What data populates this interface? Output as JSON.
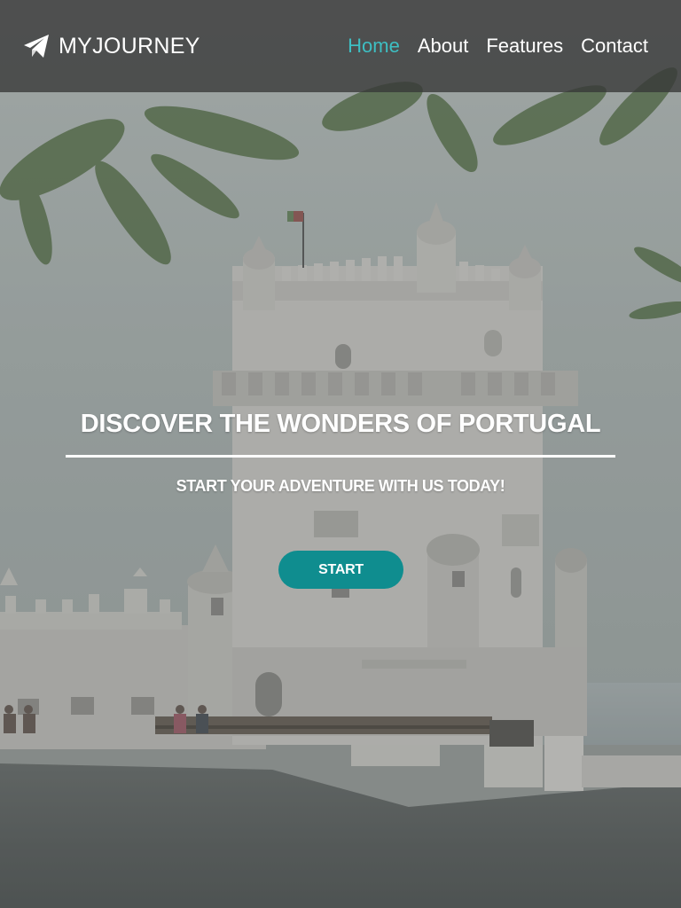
{
  "brand": {
    "name": "MYJOURNEY",
    "icon": "paper-plane-icon"
  },
  "nav": {
    "items": [
      {
        "label": "Home",
        "active": true
      },
      {
        "label": "About",
        "active": false
      },
      {
        "label": "Features",
        "active": false
      },
      {
        "label": "Contact",
        "active": false
      }
    ]
  },
  "hero": {
    "title": "DISCOVER THE WONDERS OF PORTUGAL",
    "subtitle": "START YOUR ADVENTURE WITH US TODAY!",
    "cta_label": "START",
    "background": "belem-tower-photo"
  },
  "colors": {
    "accent": "#3dbfc3",
    "button": "#0f8d8f",
    "header_bg": "#373737",
    "text": "#ffffff"
  }
}
